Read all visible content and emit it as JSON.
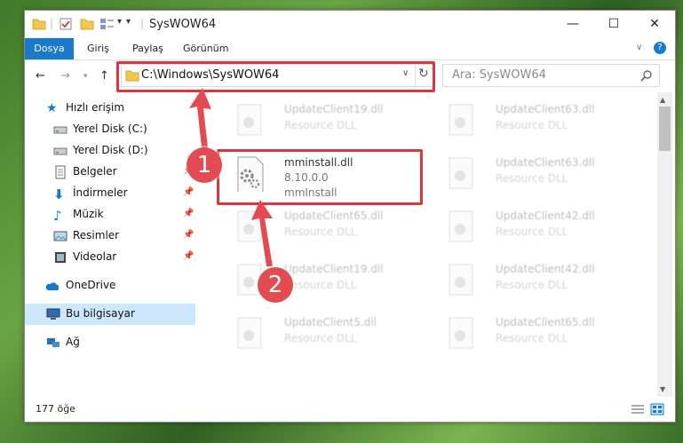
{
  "window": {
    "title": "SysWOW64",
    "controls": {
      "minimize": "—",
      "maximize": "☐",
      "close": "✕"
    }
  },
  "ribbon": {
    "tabs": [
      {
        "label": "Dosya",
        "active": true
      },
      {
        "label": "Giriş"
      },
      {
        "label": "Paylaş"
      },
      {
        "label": "Görünüm"
      }
    ],
    "help": "?"
  },
  "address": {
    "path": "C:\\Windows\\SysWOW64",
    "search_placeholder": "Ara: SysWOW64"
  },
  "sidebar": {
    "items": [
      {
        "label": "Hızlı erişim",
        "icon": "star-icon"
      },
      {
        "label": "Yerel Disk (C:)",
        "icon": "drive-icon"
      },
      {
        "label": "Yerel Disk (D:)",
        "icon": "drive-icon"
      },
      {
        "label": "Belgeler",
        "icon": "documents-icon",
        "pinned": true
      },
      {
        "label": "İndirmeler",
        "icon": "download-icon",
        "pinned": true
      },
      {
        "label": "Müzik",
        "icon": "music-icon",
        "pinned": true
      },
      {
        "label": "Resimler",
        "icon": "pictures-icon",
        "pinned": true
      },
      {
        "label": "Videolar",
        "icon": "video-icon",
        "pinned": true
      },
      {
        "label": "OneDrive",
        "icon": "cloud-icon"
      },
      {
        "label": "Bu bilgisayar",
        "icon": "computer-icon",
        "selected": true
      },
      {
        "label": "Ağ",
        "icon": "network-icon"
      }
    ]
  },
  "files": {
    "highlighted": {
      "name": "mminstall.dll",
      "version": "8.10.0.0",
      "description": "mmInstall"
    },
    "left_column": [
      {
        "name": "UpdateClient19.dll",
        "desc": "Resource DLL"
      },
      {
        "name": "UpdateClient65.dll",
        "desc": "Resource DLL"
      },
      {
        "name": "UpdateClient19.dll",
        "desc": "Resource DLL"
      },
      {
        "name": "UpdateClient5.dll",
        "desc": "Resource DLL"
      }
    ],
    "right_column": [
      {
        "name": "UpdateClient63.dll",
        "desc": "Resource DLL"
      },
      {
        "name": "UpdateClient63.dll",
        "desc": "Resource DLL"
      },
      {
        "name": "UpdateClient42.dll",
        "desc": "Resource DLL"
      },
      {
        "name": "UpdateClient42.dll",
        "desc": "Resource DLL"
      },
      {
        "name": "UpdateClient65.dll",
        "desc": "Resource DLL"
      }
    ]
  },
  "status": {
    "count": "177 öğe"
  },
  "callouts": {
    "one": "1",
    "two": "2"
  },
  "colors": {
    "accent": "#1979ca",
    "highlight_box": "#d9363e",
    "callout": "#e24b51",
    "selected": "#cce8ff"
  }
}
